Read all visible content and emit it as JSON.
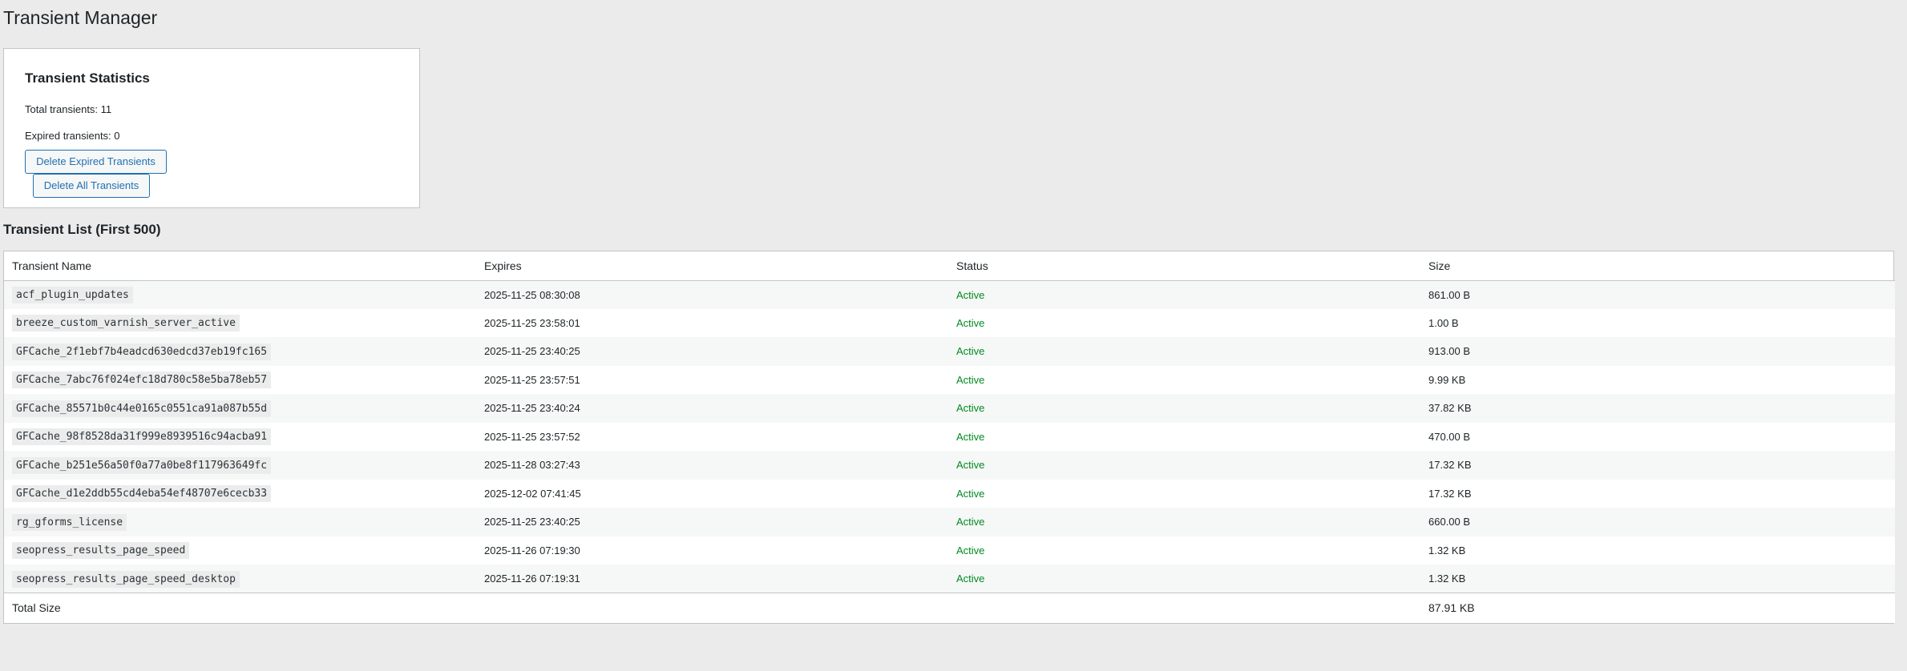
{
  "page": {
    "title": "Transient Manager"
  },
  "stats": {
    "title": "Transient Statistics",
    "total_line": "Total transients: 11",
    "expired_line": "Expired transients: 0",
    "delete_expired_label": "Delete Expired Transients",
    "delete_all_label": "Delete All Transients"
  },
  "list": {
    "title": "Transient List (First 500)",
    "columns": [
      "Transient Name",
      "Expires",
      "Status",
      "Size"
    ],
    "rows": [
      {
        "name": "acf_plugin_updates",
        "expires": "2025-11-25 08:30:08",
        "status": "Active",
        "size": "861.00 B"
      },
      {
        "name": "breeze_custom_varnish_server_active",
        "expires": "2025-11-25 23:58:01",
        "status": "Active",
        "size": "1.00 B"
      },
      {
        "name": "GFCache_2f1ebf7b4eadcd630edcd37eb19fc165",
        "expires": "2025-11-25 23:40:25",
        "status": "Active",
        "size": "913.00 B"
      },
      {
        "name": "GFCache_7abc76f024efc18d780c58e5ba78eb57",
        "expires": "2025-11-25 23:57:51",
        "status": "Active",
        "size": "9.99 KB"
      },
      {
        "name": "GFCache_85571b0c44e0165c0551ca91a087b55d",
        "expires": "2025-11-25 23:40:24",
        "status": "Active",
        "size": "37.82 KB"
      },
      {
        "name": "GFCache_98f8528da31f999e8939516c94acba91",
        "expires": "2025-11-25 23:57:52",
        "status": "Active",
        "size": "470.00 B"
      },
      {
        "name": "GFCache_b251e56a50f0a77a0be8f117963649fc",
        "expires": "2025-11-28 03:27:43",
        "status": "Active",
        "size": "17.32 KB"
      },
      {
        "name": "GFCache_d1e2ddb55cd4eba54ef48707e6cecb33",
        "expires": "2025-12-02 07:41:45",
        "status": "Active",
        "size": "17.32 KB"
      },
      {
        "name": "rg_gforms_license",
        "expires": "2025-11-25 23:40:25",
        "status": "Active",
        "size": "660.00 B"
      },
      {
        "name": "seopress_results_page_speed",
        "expires": "2025-11-26 07:19:30",
        "status": "Active",
        "size": "1.32 KB"
      },
      {
        "name": "seopress_results_page_speed_desktop",
        "expires": "2025-11-26 07:19:31",
        "status": "Active",
        "size": "1.32 KB"
      }
    ],
    "footer": {
      "label": "Total Size",
      "total": "87.91 KB"
    }
  },
  "colors": {
    "background": "#ebebeb",
    "link_blue": "#2271b1",
    "status_active": "#008a20"
  }
}
